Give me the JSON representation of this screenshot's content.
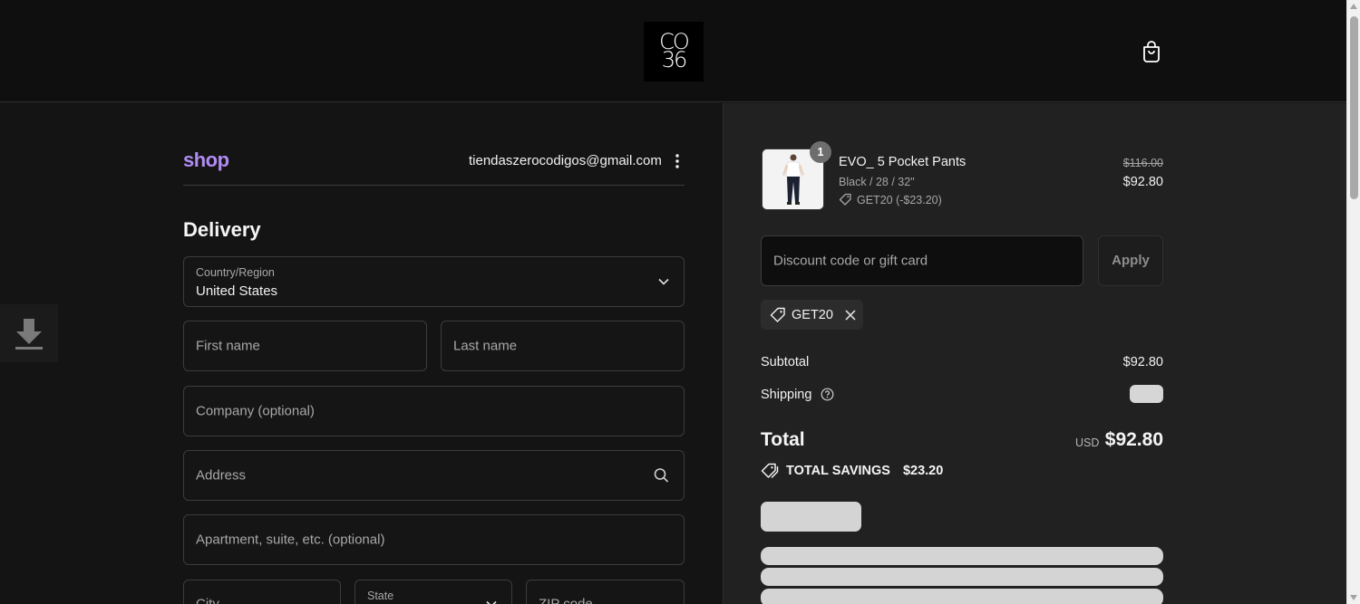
{
  "header": {
    "logo_line1": "CO",
    "logo_line2": "36",
    "cart_icon": "shopping-bag-icon"
  },
  "account": {
    "shop_brand": "shop",
    "email": "tiendaszerocodigos@gmail.com",
    "menu_icon": "kebab-menu-icon"
  },
  "delivery": {
    "title": "Delivery",
    "country_label": "Country/Region",
    "country_value": "United States",
    "first_name_placeholder": "First name",
    "last_name_placeholder": "Last name",
    "company_placeholder": "Company (optional)",
    "address_placeholder": "Address",
    "apartment_placeholder": "Apartment, suite, etc. (optional)",
    "city_placeholder": "City",
    "state_label": "State",
    "zip_placeholder": "ZIP code"
  },
  "order": {
    "item": {
      "quantity": "1",
      "name": "EVO_ 5 Pocket Pants",
      "variant": "Black / 28 / 32\"",
      "discount": "GET20 (-$23.20)",
      "original_price": "$116.00",
      "price": "$92.80"
    },
    "discount_placeholder": "Discount code or gift card",
    "apply_label": "Apply",
    "applied_code": "GET20",
    "subtotal_label": "Subtotal",
    "subtotal_value": "$92.80",
    "shipping_label": "Shipping",
    "total_label": "Total",
    "currency": "USD",
    "total_value": "$92.80",
    "savings_label": "TOTAL SAVINGS",
    "savings_value": "$23.20"
  },
  "colors": {
    "background": "#141414",
    "summary_background": "#212121",
    "shop_brand": "#b18cf3"
  }
}
